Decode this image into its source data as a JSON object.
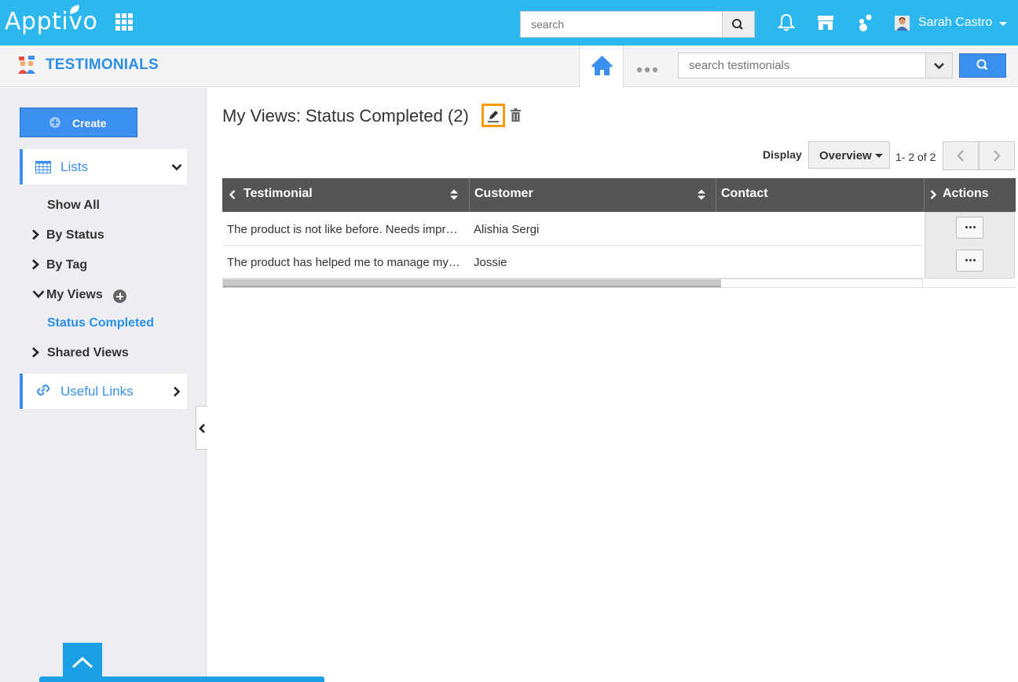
{
  "topbar": {
    "brand": "Apptivo",
    "search_placeholder": "search",
    "user_name": "Sarah Castro",
    "icons": [
      "apps-grid-icon",
      "search-icon",
      "bell-icon",
      "store-icon",
      "apps-dots-icon",
      "avatar",
      "caret-down-icon"
    ]
  },
  "appbar": {
    "title": "TESTIMONIALS",
    "search_placeholder": "search testimonials"
  },
  "sidebar": {
    "create_label": "Create",
    "lists_label": "Lists",
    "items": [
      {
        "label": "Show All"
      },
      {
        "label": "By Status"
      },
      {
        "label": "By Tag"
      },
      {
        "label": "My Views"
      },
      {
        "label": "Status Completed"
      },
      {
        "label": "Shared Views"
      }
    ],
    "useful_links_label": "Useful Links"
  },
  "main": {
    "view_title": "My Views: Status Completed (2)",
    "display_label": "Display",
    "display_value": "Overview",
    "pager_text": "1- 2 of 2",
    "columns": [
      "Testimonial",
      "Customer",
      "Contact",
      "Actions"
    ],
    "rows": [
      {
        "testimonial": "The product is not like before. Needs impro…",
        "customer": "Alishia Sergi",
        "contact": ""
      },
      {
        "testimonial": "The product has helped me to manage my …",
        "customer": "Jossie",
        "contact": ""
      }
    ]
  },
  "colors": {
    "topbar": "#2cb7ef",
    "accent": "#3b8fef",
    "title_blue": "#2b8fe6",
    "header_gray": "#555555",
    "highlight_orange": "#ff9900"
  }
}
